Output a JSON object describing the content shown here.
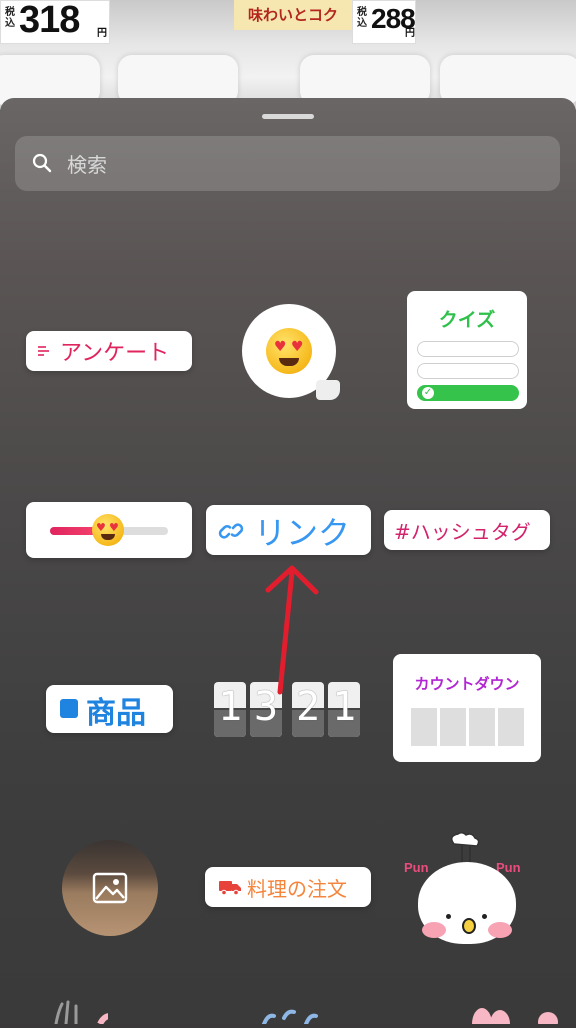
{
  "background": {
    "price_tag_1": {
      "small": "税込",
      "price": "318",
      "yen": "円"
    },
    "flavor_tag": "味わいとコク",
    "price_tag_2": {
      "small": "税込",
      "price": "288",
      "yen": "円"
    }
  },
  "sheet": {
    "search": {
      "placeholder": "検索"
    },
    "stickers": {
      "poll": "アンケート",
      "quiz": "クイズ",
      "link": "リンク",
      "hashtag": "#ハッシュタグ",
      "product": "商品",
      "countdown_clock": [
        "1",
        "3",
        "2",
        "1"
      ],
      "countdown": "カウントダウン",
      "food_order": "料理の注文",
      "character": {
        "left": "Pun",
        "right": "Pun"
      }
    }
  },
  "colors": {
    "poll": "#e0245e",
    "quiz": "#2fc14b",
    "link": "#3897f0",
    "hashtag": "#d3236d",
    "product": "#1f83e0",
    "countdown": "#b225d2",
    "food_order": "#f4853c",
    "annotation_arrow": "#e11d2e"
  },
  "icons": {
    "search": "search-icon",
    "link": "link-icon",
    "product": "shopping-bag-icon",
    "photo": "image-icon",
    "food_order": "delivery-truck-icon"
  }
}
